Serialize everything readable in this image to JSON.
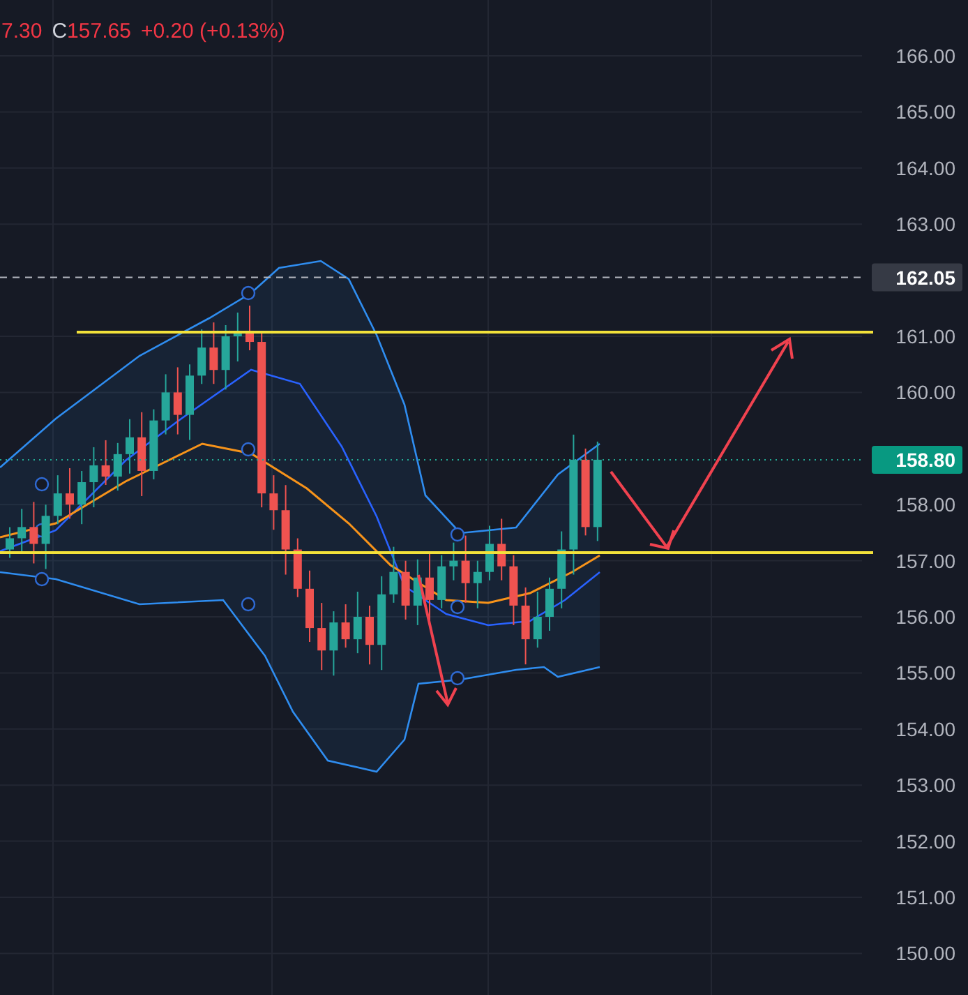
{
  "header": {
    "open_tail": "7.30",
    "close_label": "C",
    "close": "157.65",
    "change": "+0.20 (+0.13%)"
  },
  "price_axis": {
    "ticks": [
      "166.00",
      "165.00",
      "164.00",
      "163.00",
      "161.00",
      "160.00",
      "158.00",
      "157.00",
      "156.00",
      "155.00",
      "154.00",
      "153.00",
      "152.00",
      "151.00",
      "150.00"
    ]
  },
  "price_tags": [
    {
      "kind": "high",
      "value": "162.05"
    },
    {
      "kind": "current",
      "value": "158.80"
    }
  ]
}
